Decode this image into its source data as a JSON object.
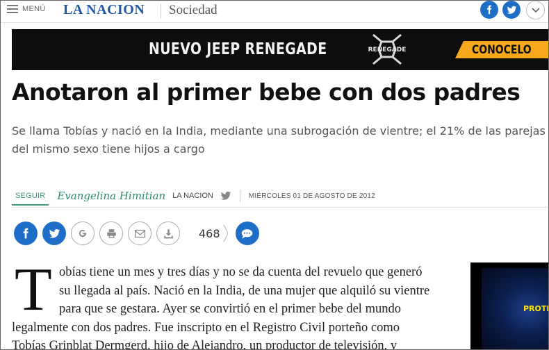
{
  "header": {
    "menu_label": "MENÚ",
    "brand": "LA NACION",
    "section": "Sociedad",
    "icons": [
      "facebook-icon",
      "twitter-icon",
      "chevron-down-icon"
    ],
    "brand_color": "#1f5aa6",
    "social_color": "#1e6ec8"
  },
  "ad": {
    "headline": "NUEVO JEEP RENEGADE",
    "logo_text": "RENEGADE",
    "cta": "CONOCELO",
    "cta_color": "#f7a81b"
  },
  "article": {
    "title": "Anotaron al primer bebe con dos padres",
    "dek": "Se llama Tobías y nació en la India, mediante una subrogación de vientre; el 21% de las parejas del mismo sexo tiene hijos a cargo",
    "follow_label": "SEGUIR",
    "author": "Evangelina Himitian",
    "outlet": "LA NACION",
    "date": "MIÉRCOLES 01 DE AGOSTO DE 2012",
    "share_icons": [
      "facebook-icon",
      "twitter-icon",
      "google-icon",
      "print-icon",
      "email-icon",
      "download-icon",
      "comment-icon"
    ],
    "comment_count": "468",
    "dropcap": "T",
    "body_lines": [
      "obías tiene un mes y tres días y no se da cuenta del revuelo que generó",
      "su llegada al país. Nació en la India, de una mujer que alquiló su vientre",
      "para que se gestara. Ayer se convirtió en el primer bebe del mundo",
      "legalmente con dos padres. Fue inscripto en el Registro Civil porteño como",
      "Tobías Grinblat Dermgerd, hijo de Alejandro, un productor de televisión, y"
    ],
    "accent_color": "#3c9a7e"
  },
  "side_video": {
    "text": "PROTI"
  }
}
